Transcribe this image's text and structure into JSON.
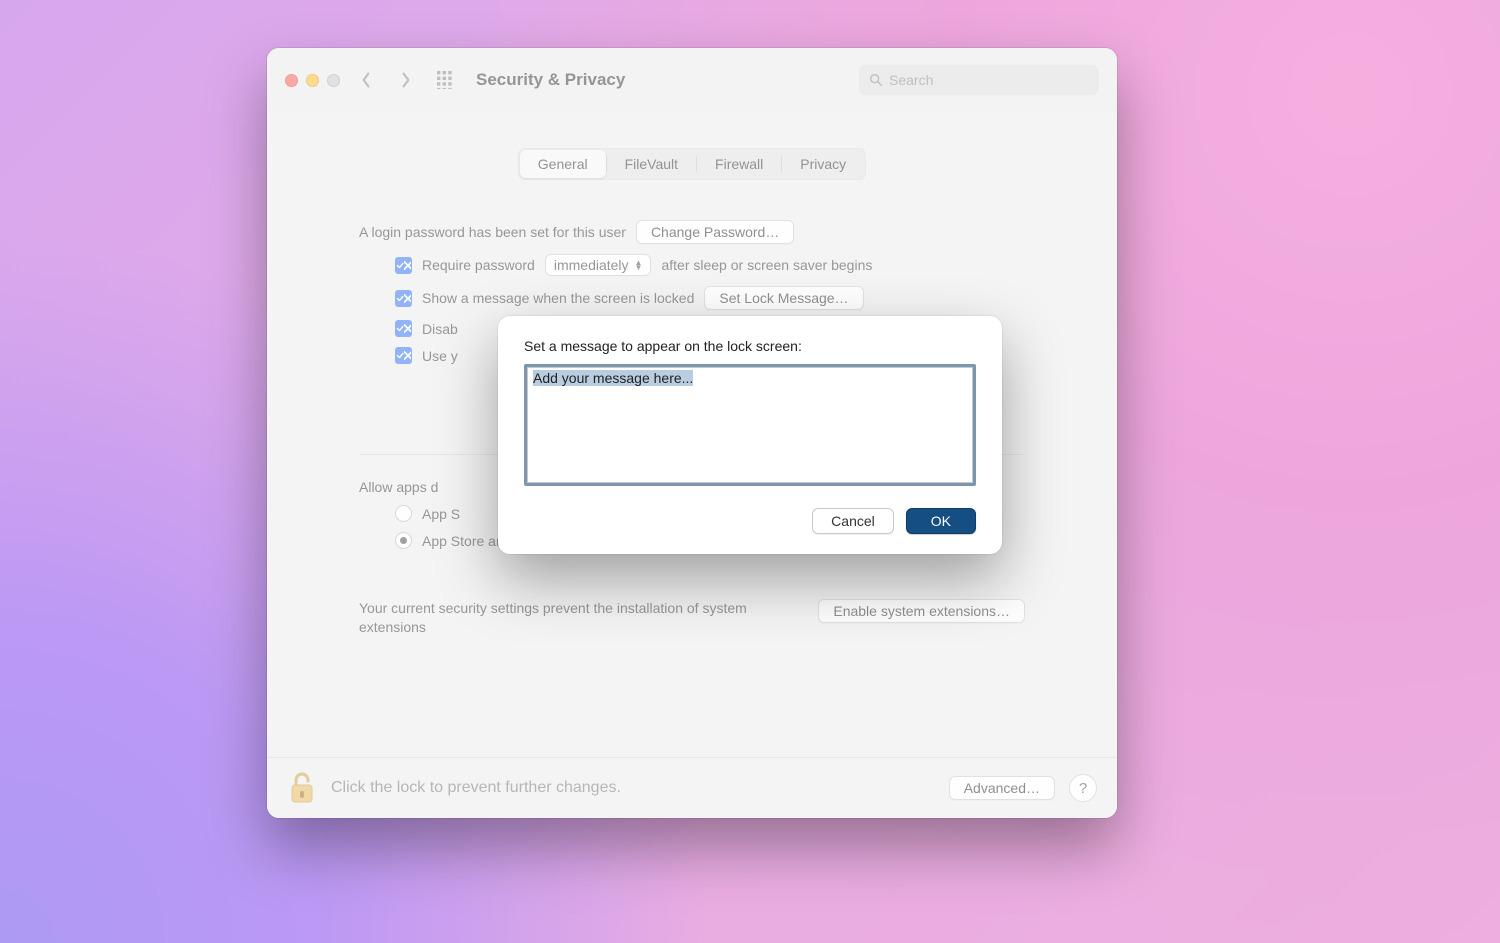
{
  "window": {
    "title": "Security & Privacy",
    "search_placeholder": "Search"
  },
  "tabs": {
    "items": [
      "General",
      "FileVault",
      "Firewall",
      "Privacy"
    ],
    "active": "General"
  },
  "general": {
    "login_text": "A login password has been set for this user",
    "change_password_btn": "Change Password…",
    "require_pw_label": "Require password",
    "require_pw_delay": "immediately",
    "require_pw_suffix": "after sleep or screen saver begins",
    "show_msg_label": "Show a message when the screen is locked",
    "set_lock_msg_btn": "Set Lock Message…",
    "disable_auto_label": "Disab",
    "use_watch_label": "Use y",
    "allow_apps_label": "Allow apps d",
    "radio_appstore": "App S",
    "radio_identified": "App Store and identified developers",
    "ext_text": "Your current security settings prevent the installation of system extensions",
    "enable_ext_btn": "Enable system extensions…"
  },
  "footer": {
    "lock_text": "Click the lock to prevent further changes.",
    "advanced_btn": "Advanced…"
  },
  "sheet": {
    "prompt": "Set a message to appear on the lock screen:",
    "textarea_value": "Add your message here...",
    "cancel": "Cancel",
    "ok": "OK"
  }
}
